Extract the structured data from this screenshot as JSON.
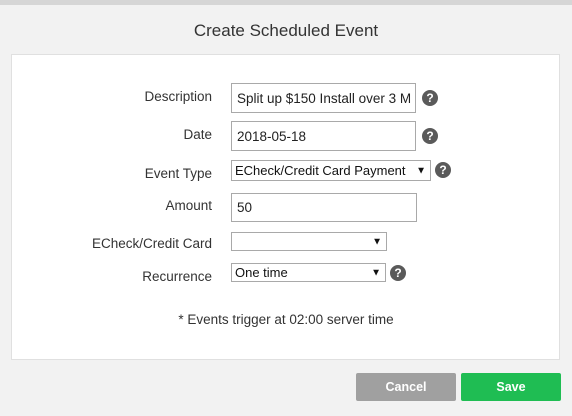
{
  "dialog": {
    "title": "Create Scheduled Event"
  },
  "form": {
    "description": {
      "label": "Description",
      "value": "Split up $150 Install over 3 M"
    },
    "date": {
      "label": "Date",
      "value": "2018-05-18"
    },
    "event_type": {
      "label": "Event Type",
      "value": "ECheck/Credit Card Payment"
    },
    "amount": {
      "label": "Amount",
      "value": "50"
    },
    "echeck_card": {
      "label": "ECheck/Credit Card",
      "value": ""
    },
    "recurrence": {
      "label": "Recurrence",
      "value": "One time"
    }
  },
  "note": "* Events trigger at 02:00 server time",
  "buttons": {
    "cancel": "Cancel",
    "save": "Save"
  },
  "icons": {
    "help": "help-icon",
    "dropdown": "chevron-down-icon"
  },
  "colors": {
    "save": "#1fbd53",
    "cancel": "#a0a0a0",
    "help": "#5a5a5a"
  }
}
